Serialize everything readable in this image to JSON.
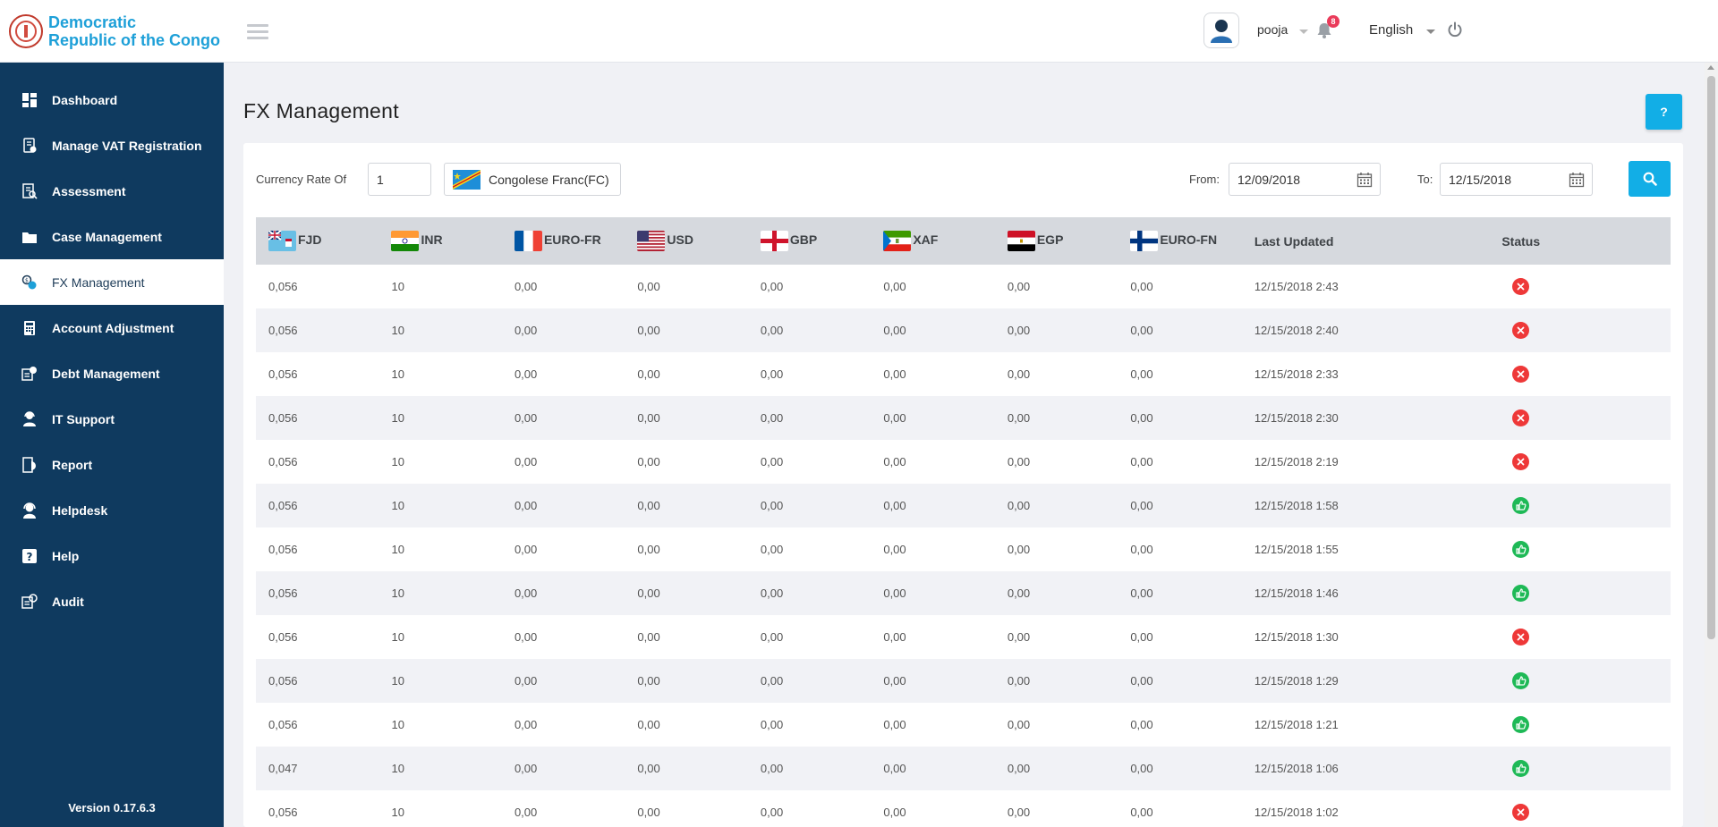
{
  "brand": {
    "name_line1": "Democratic",
    "name_line2": "Republic of the Congo"
  },
  "sidebar": {
    "items": [
      {
        "label": "Dashboard",
        "icon": "dashboard-icon"
      },
      {
        "label": "Manage VAT Registration",
        "icon": "vat-registration-icon"
      },
      {
        "label": "Assessment",
        "icon": "assessment-icon"
      },
      {
        "label": "Case Management",
        "icon": "case-management-icon"
      },
      {
        "label": "FX Management",
        "icon": "fx-management-icon",
        "active": true
      },
      {
        "label": "Account Adjustment",
        "icon": "account-adjustment-icon"
      },
      {
        "label": "Debt Management",
        "icon": "debt-management-icon"
      },
      {
        "label": "IT Support",
        "icon": "it-support-icon"
      },
      {
        "label": "Report",
        "icon": "report-icon"
      },
      {
        "label": "Helpdesk",
        "icon": "helpdesk-icon"
      },
      {
        "label": "Help",
        "icon": "help-icon"
      },
      {
        "label": "Audit",
        "icon": "audit-icon"
      }
    ],
    "version": "Version 0.17.6.3"
  },
  "header": {
    "username": "pooja",
    "notifications": "8",
    "language": "English"
  },
  "page": {
    "title": "FX Management",
    "help_label": "?"
  },
  "filters": {
    "currency_rate_label": "Currency Rate Of",
    "currency_rate_value": "1",
    "currency_name": "Congolese Franc(FC)",
    "from_label": "From:",
    "from_value": "12/09/2018",
    "to_label": "To:",
    "to_value": "12/15/2018"
  },
  "table": {
    "columns": [
      "FJD",
      "INR",
      "EURO-FR",
      "USD",
      "GBP",
      "XAF",
      "EGP",
      "EURO-FN",
      "Last Updated",
      "Status"
    ],
    "rows": [
      [
        "0,056",
        "10",
        "0,00",
        "0,00",
        "0,00",
        "0,00",
        "0,00",
        "0,00",
        "12/15/2018 2:43",
        "fail"
      ],
      [
        "0,056",
        "10",
        "0,00",
        "0,00",
        "0,00",
        "0,00",
        "0,00",
        "0,00",
        "12/15/2018 2:40",
        "fail"
      ],
      [
        "0,056",
        "10",
        "0,00",
        "0,00",
        "0,00",
        "0,00",
        "0,00",
        "0,00",
        "12/15/2018 2:33",
        "fail"
      ],
      [
        "0,056",
        "10",
        "0,00",
        "0,00",
        "0,00",
        "0,00",
        "0,00",
        "0,00",
        "12/15/2018 2:30",
        "fail"
      ],
      [
        "0,056",
        "10",
        "0,00",
        "0,00",
        "0,00",
        "0,00",
        "0,00",
        "0,00",
        "12/15/2018 2:19",
        "fail"
      ],
      [
        "0,056",
        "10",
        "0,00",
        "0,00",
        "0,00",
        "0,00",
        "0,00",
        "0,00",
        "12/15/2018 1:58",
        "ok"
      ],
      [
        "0,056",
        "10",
        "0,00",
        "0,00",
        "0,00",
        "0,00",
        "0,00",
        "0,00",
        "12/15/2018 1:55",
        "ok"
      ],
      [
        "0,056",
        "10",
        "0,00",
        "0,00",
        "0,00",
        "0,00",
        "0,00",
        "0,00",
        "12/15/2018 1:46",
        "ok"
      ],
      [
        "0,056",
        "10",
        "0,00",
        "0,00",
        "0,00",
        "0,00",
        "0,00",
        "0,00",
        "12/15/2018 1:30",
        "fail"
      ],
      [
        "0,056",
        "10",
        "0,00",
        "0,00",
        "0,00",
        "0,00",
        "0,00",
        "0,00",
        "12/15/2018 1:29",
        "ok"
      ],
      [
        "0,056",
        "10",
        "0,00",
        "0,00",
        "0,00",
        "0,00",
        "0,00",
        "0,00",
        "12/15/2018 1:21",
        "ok"
      ],
      [
        "0,047",
        "10",
        "0,00",
        "0,00",
        "0,00",
        "0,00",
        "0,00",
        "0,00",
        "12/15/2018 1:06",
        "ok"
      ],
      [
        "0,056",
        "10",
        "0,00",
        "0,00",
        "0,00",
        "0,00",
        "0,00",
        "0,00",
        "12/15/2018 1:02",
        "fail"
      ]
    ]
  },
  "colors": {
    "sidebar_bg": "#0f3a5f",
    "accent": "#12aee6",
    "status_fail": "#ee3838",
    "status_ok": "#1eb956",
    "badge": "#ea3b5a"
  }
}
